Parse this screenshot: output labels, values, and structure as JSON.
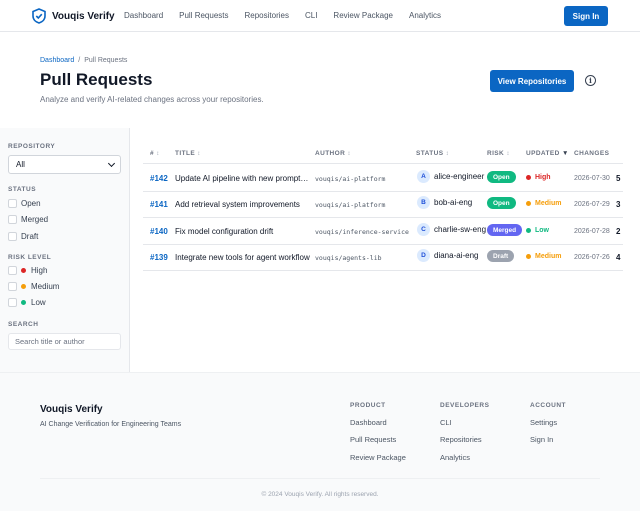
{
  "header": {
    "brand": "Vouqis Verify",
    "nav": [
      "Dashboard",
      "Pull Requests",
      "Repositories",
      "CLI",
      "Review Package",
      "Analytics"
    ],
    "signin_label": "Sign In"
  },
  "page": {
    "breadcrumb": [
      "Dashboard",
      "Pull Requests"
    ],
    "title": "Pull Requests",
    "subtitle": "Analyze and verify AI-related changes across your repositories.",
    "view_repos_label": "View Repositories",
    "info_icon": "info-icon"
  },
  "sidebar": {
    "repository_label": "REPOSITORY",
    "repository_value": "All",
    "status_label": "STATUS",
    "status_options": [
      "Open",
      "Merged",
      "Draft"
    ],
    "risk_label": "RISK LEVEL",
    "risk_options": [
      {
        "label": "High",
        "color": "#dc2626"
      },
      {
        "label": "Medium",
        "color": "#f59e0b"
      },
      {
        "label": "Low",
        "color": "#10b981"
      }
    ],
    "search_label": "SEARCH",
    "search_placeholder": "Search title or author"
  },
  "table": {
    "columns": [
      "#",
      "TITLE",
      "AUTHOR",
      "STATUS",
      "RISK",
      "UPDATED",
      "CHANGES"
    ],
    "sorted_column": "UPDATED",
    "rows": [
      {
        "num": "#142",
        "title": "Update AI pipeline with new prompt vers...",
        "author": "vouqis/ai-platform",
        "initial": "A",
        "user": "alice-engineer",
        "status": "Open",
        "status_color": "#10b981",
        "risk": "High",
        "risk_color": "#dc2626",
        "updated": "2026-07-30",
        "changes": "5"
      },
      {
        "num": "#141",
        "title": "Add retrieval system improvements",
        "author": "vouqis/ai-platform",
        "initial": "B",
        "user": "bob-ai-eng",
        "status": "Open",
        "status_color": "#10b981",
        "risk": "Medium",
        "risk_color": "#f59e0b",
        "updated": "2026-07-29",
        "changes": "3"
      },
      {
        "num": "#140",
        "title": "Fix model configuration drift",
        "author": "vouqis/inference-service",
        "initial": "C",
        "user": "charlie-sw-eng",
        "status": "Merged",
        "status_color": "#6366f1",
        "risk": "Low",
        "risk_color": "#10b981",
        "updated": "2026-07-28",
        "changes": "2"
      },
      {
        "num": "#139",
        "title": "Integrate new tools for agent workflow",
        "author": "vouqis/agents-lib",
        "initial": "D",
        "user": "diana-ai-eng",
        "status": "Draft",
        "status_color": "#9ca3af",
        "risk": "Medium",
        "risk_color": "#f59e0b",
        "updated": "2026-07-26",
        "changes": "4"
      }
    ]
  },
  "footer": {
    "brand": "Vouqis Verify",
    "tagline": "AI Change Verification for Engineering Teams",
    "columns": [
      {
        "heading": "PRODUCT",
        "links": [
          "Dashboard",
          "Pull Requests",
          "Review Package"
        ]
      },
      {
        "heading": "DEVELOPERS",
        "links": [
          "CLI",
          "Repositories",
          "Analytics"
        ]
      },
      {
        "heading": "ACCOUNT",
        "links": [
          "Settings",
          "Sign In"
        ]
      }
    ],
    "copyright": "© 2024 Vouqis Verify. All rights reserved."
  },
  "colors": {
    "accent": "#0b66c3"
  }
}
